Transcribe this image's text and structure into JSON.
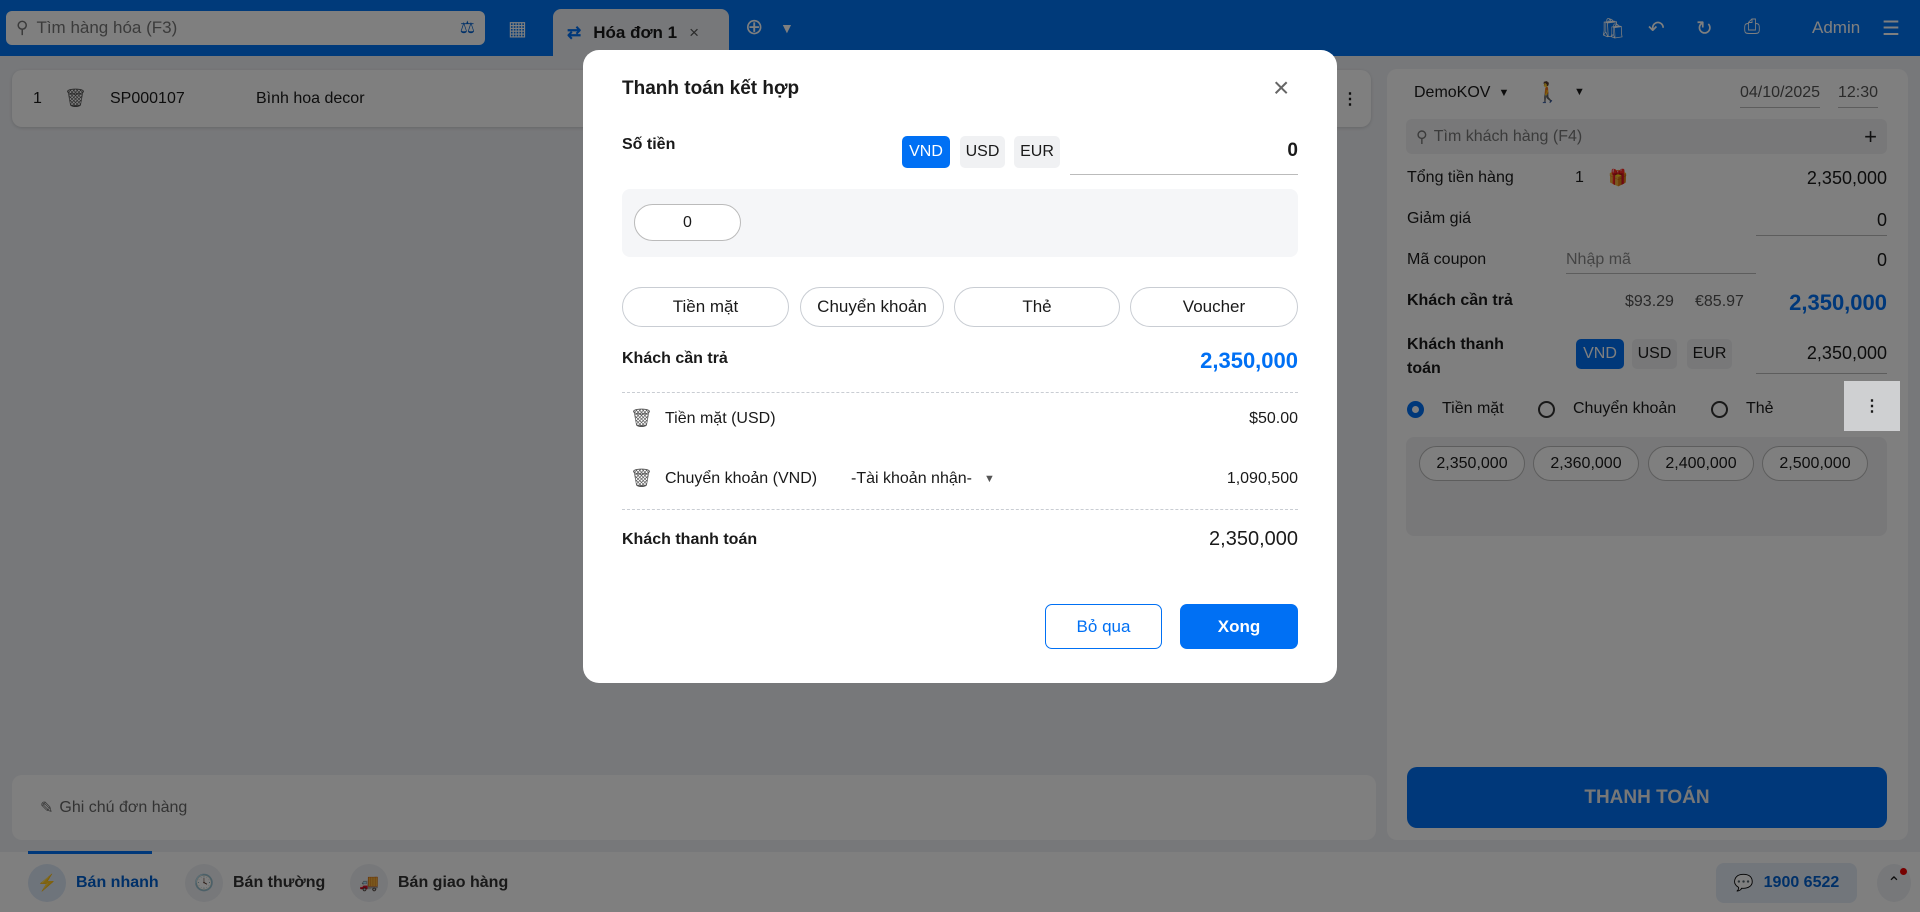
{
  "header": {
    "search_placeholder": "Tìm hàng hóa (F3)",
    "tab_label": "Hóa đơn 1",
    "user": "Admin"
  },
  "cart": {
    "items": [
      {
        "index": "1",
        "code": "SP000107",
        "name": "Bình hoa decor"
      }
    ],
    "note_placeholder": "Ghi chú đơn hàng"
  },
  "right_panel": {
    "branch": "DemoKOV",
    "date": "04/10/2025",
    "time": "12:30",
    "customer_search_placeholder": "Tìm khách hàng (F4)",
    "total_label": "Tổng tiền hàng",
    "total_qty": "1",
    "total_value": "2,350,000",
    "discount_label": "Giảm giá",
    "discount_value": "0",
    "coupon_label": "Mã coupon",
    "coupon_placeholder": "Nhập mã",
    "coupon_value": "0",
    "need_pay_label": "Khách cần trả",
    "need_pay_usd": "$93.29",
    "need_pay_eur": "€85.97",
    "need_pay_value": "2,350,000",
    "customer_pay_label": "Khách thanh toán",
    "currencies": [
      "VND",
      "USD",
      "EUR"
    ],
    "customer_pay_value": "2,350,000",
    "methods": [
      "Tiền mặt",
      "Chuyển khoản",
      "Thẻ"
    ],
    "quick_amounts": [
      "2,350,000",
      "2,360,000",
      "2,400,000",
      "2,500,000"
    ],
    "pay_button": "THANH TOÁN"
  },
  "bottom": {
    "modes": [
      "Bán nhanh",
      "Bán thường",
      "Bán giao hàng"
    ],
    "hotline": "1900 6522"
  },
  "modal": {
    "title": "Thanh toán kết hợp",
    "amount_label": "Số tiền",
    "currencies": [
      "VND",
      "USD",
      "EUR"
    ],
    "amount_value": "0",
    "suggest": "0",
    "methods": [
      "Tiền mặt",
      "Chuyển khoản",
      "Thẻ",
      "Voucher"
    ],
    "need_pay_label": "Khách cần trả",
    "need_pay_value": "2,350,000",
    "payments": [
      {
        "label": "Tiền mặt (USD)",
        "value": "$50.00"
      },
      {
        "label": "Chuyển khoản (VND)",
        "account": "-Tài khoản nhận-",
        "value": "1,090,500"
      }
    ],
    "paid_label": "Khách thanh toán",
    "paid_value": "2,350,000",
    "cancel": "Bỏ qua",
    "done": "Xong"
  },
  "colors": {
    "primary": "#0070f4"
  }
}
